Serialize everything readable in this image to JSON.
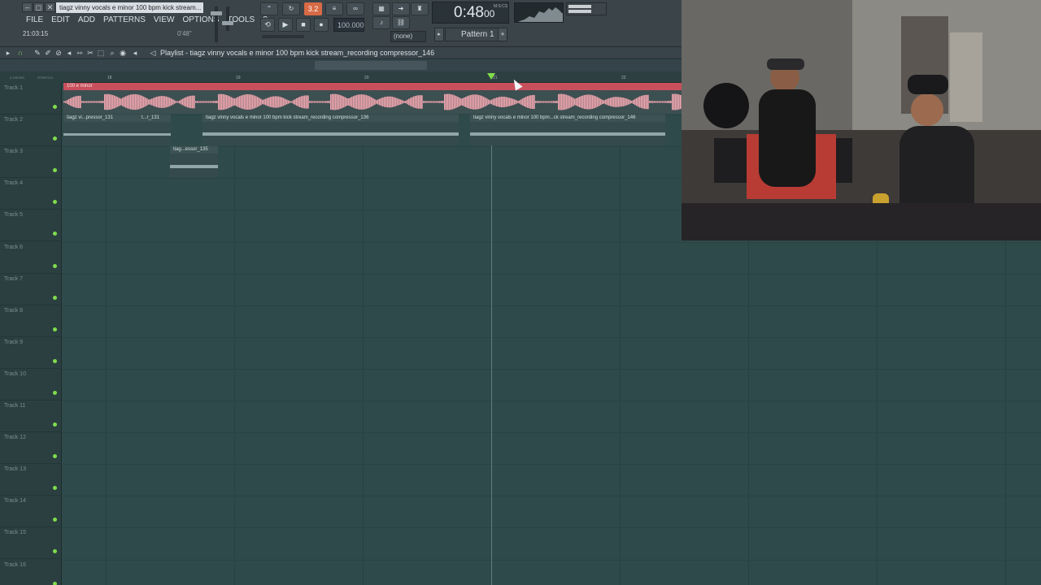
{
  "window": {
    "title": "tiagz vinny vocals e minor 100 bpm kick stream..."
  },
  "menu": [
    "FILE",
    "EDIT",
    "ADD",
    "PATTERNS",
    "VIEW",
    "OPTIONS",
    "TOOLS",
    "?"
  ],
  "hint": {
    "left": "21:03:15",
    "right": "0'48\""
  },
  "transport": {
    "song_mode": "3.2",
    "tempo": "100.000",
    "time_main": "0:48",
    "time_sub": "00",
    "time_label": "M:S:CS",
    "pattern": "Pattern 1",
    "pattern_arrow": "▸",
    "pattern_plus": "+",
    "none_label": "(none)"
  },
  "playlist": {
    "title": "Playlist - tiagz vinny vocals e minor 100 bpm kick stream_recording compressor_146"
  },
  "zoom_labels": [
    "Z-CROSS",
    "STRETCH"
  ],
  "ruler": {
    "bars": [
      "18",
      "19",
      "20",
      "21",
      "22"
    ]
  },
  "tracks": [
    "Track 1",
    "Track 2",
    "Track 3",
    "Track 4",
    "Track 5",
    "Track 6",
    "Track 7",
    "Track 8",
    "Track 9",
    "Track 10",
    "Track 11",
    "Track 12",
    "Track 13",
    "Track 14",
    "Track 15",
    "Track 16"
  ],
  "clips": {
    "main": "100 e minor",
    "t2a": "tiagz vi...pressor_131",
    "t2b": "t...r_131",
    "t2c": "tiagz vinny vocals e minor 100 bpm kick stream_recording compressor_136",
    "t2d": "tiagz vinny vocals e minor 100 bpm...ck stream_recording compressor_146",
    "t3a": "tiag...essor_135"
  },
  "colors": {
    "grid_bg": "#2f4a4b",
    "main_clip": "#c8505c",
    "waveform_pink": "#f3a7b1",
    "led": "#7fdd4b"
  }
}
